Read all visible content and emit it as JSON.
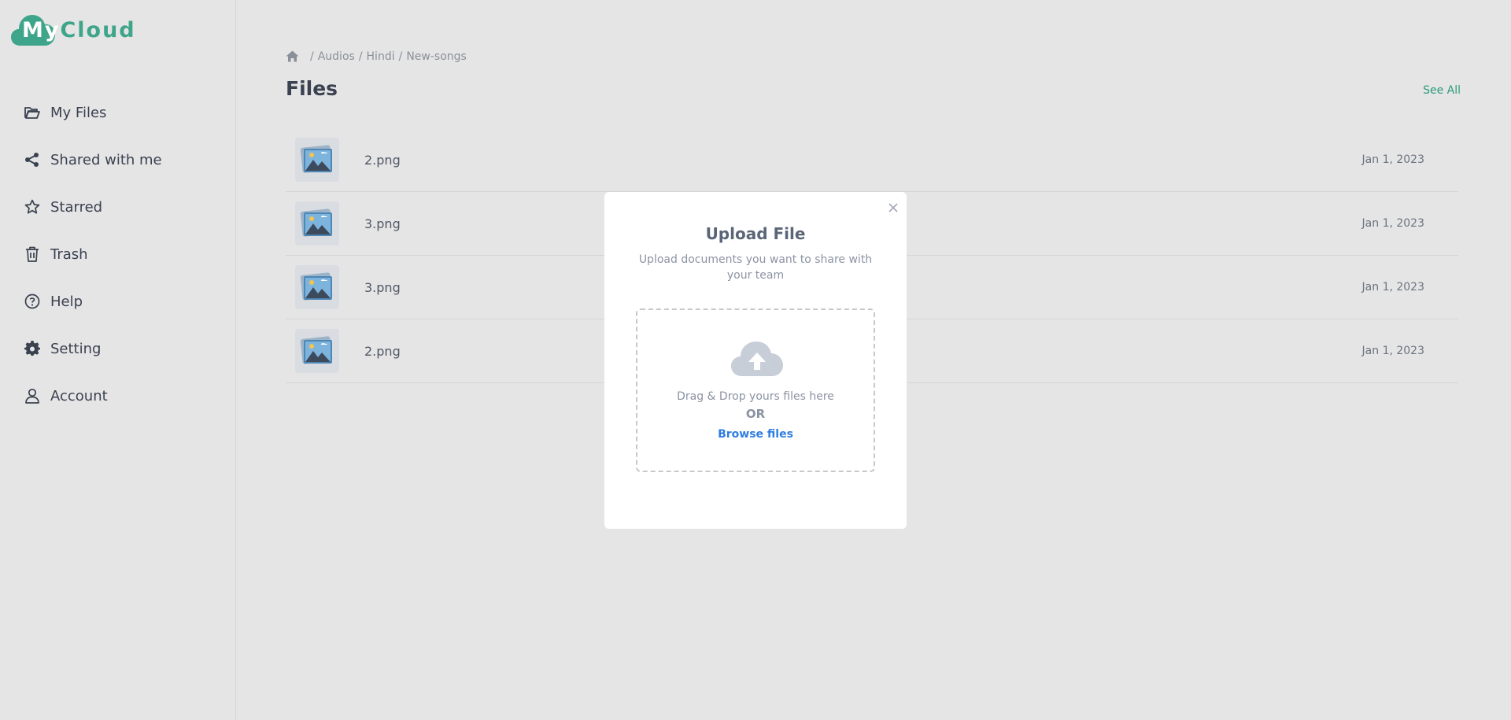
{
  "app": {
    "logo_prefix": "My",
    "logo_suffix": "Cloud",
    "brand_color": "#3fa58a"
  },
  "sidebar": {
    "items": [
      {
        "label": "My Files",
        "icon": "folder-open-icon"
      },
      {
        "label": "Shared with me",
        "icon": "share-icon"
      },
      {
        "label": "Starred",
        "icon": "star-icon"
      },
      {
        "label": "Trash",
        "icon": "trash-icon"
      },
      {
        "label": "Help",
        "icon": "help-circle-icon"
      },
      {
        "label": "Setting",
        "icon": "gear-icon"
      },
      {
        "label": "Account",
        "icon": "user-icon"
      }
    ]
  },
  "breadcrumb": {
    "home_icon": "home-icon",
    "items": [
      "Audios",
      "Hindi",
      "New-songs"
    ],
    "separator": "/"
  },
  "main": {
    "title": "Files",
    "see_all": "See All",
    "files": [
      {
        "name": "2.png",
        "date": "Jan 1, 2023",
        "icon": "image-file-icon"
      },
      {
        "name": "3.png",
        "date": "Jan 1, 2023",
        "icon": "image-file-icon"
      },
      {
        "name": "3.png",
        "date": "Jan 1, 2023",
        "icon": "image-file-icon"
      },
      {
        "name": "2.png",
        "date": "Jan 1, 2023",
        "icon": "image-file-icon"
      }
    ]
  },
  "modal": {
    "title": "Upload File",
    "subtitle": "Upload documents you want to share with your team",
    "drop_text": "Drag & Drop yours files here",
    "or_text": "OR",
    "browse_label": "Browse files",
    "close_icon": "close-icon",
    "upload_icon": "cloud-upload-icon",
    "accent_color": "#2f7de1"
  }
}
